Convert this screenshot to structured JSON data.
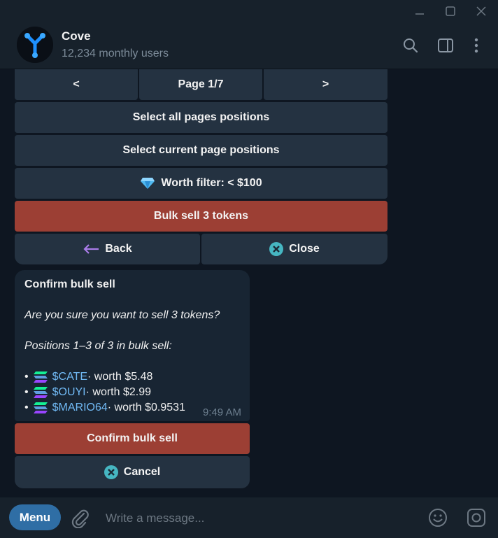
{
  "window": {
    "minimize_icon": "minimize-icon",
    "maximize_icon": "maximize-icon",
    "close_icon": "close-icon"
  },
  "header": {
    "name": "Cove",
    "subtitle": "12,234 monthly users",
    "icons": [
      "search-icon",
      "sidebar-toggle-icon",
      "more-vertical-icon"
    ]
  },
  "keyboard": {
    "prev": "<",
    "page": "Page 1/7",
    "next": ">",
    "select_all": "Select all pages positions",
    "select_current": "Select current page positions",
    "worth_filter": "Worth filter: < $100",
    "bulk_sell": "Bulk sell 3 tokens",
    "back": "Back",
    "close": "Close"
  },
  "message": {
    "title": "Confirm bulk sell",
    "question": "Are you sure you want to sell 3 tokens?",
    "positions_label": "Positions 1–3 of 3 in bulk sell:",
    "positions": [
      {
        "bullet": "•",
        "ticker": "$CATE",
        "worth": " · worth $5.48"
      },
      {
        "bullet": "•",
        "ticker": "$OUYI",
        "worth": " · worth $2.99"
      },
      {
        "bullet": "•",
        "ticker": "$MARIO64",
        "worth": " · worth $0.9531"
      }
    ],
    "time": "9:49 AM"
  },
  "confirm_keyboard": {
    "confirm": "Confirm bulk sell",
    "cancel": "Cancel"
  },
  "input": {
    "menu": "Menu",
    "placeholder": "Write a message..."
  },
  "colors": {
    "background": "#0e1621",
    "panel": "#17212b",
    "button": "#243241",
    "danger_button": "#9c3f34",
    "link": "#71baf5",
    "menu_button": "#2f6ea5"
  }
}
